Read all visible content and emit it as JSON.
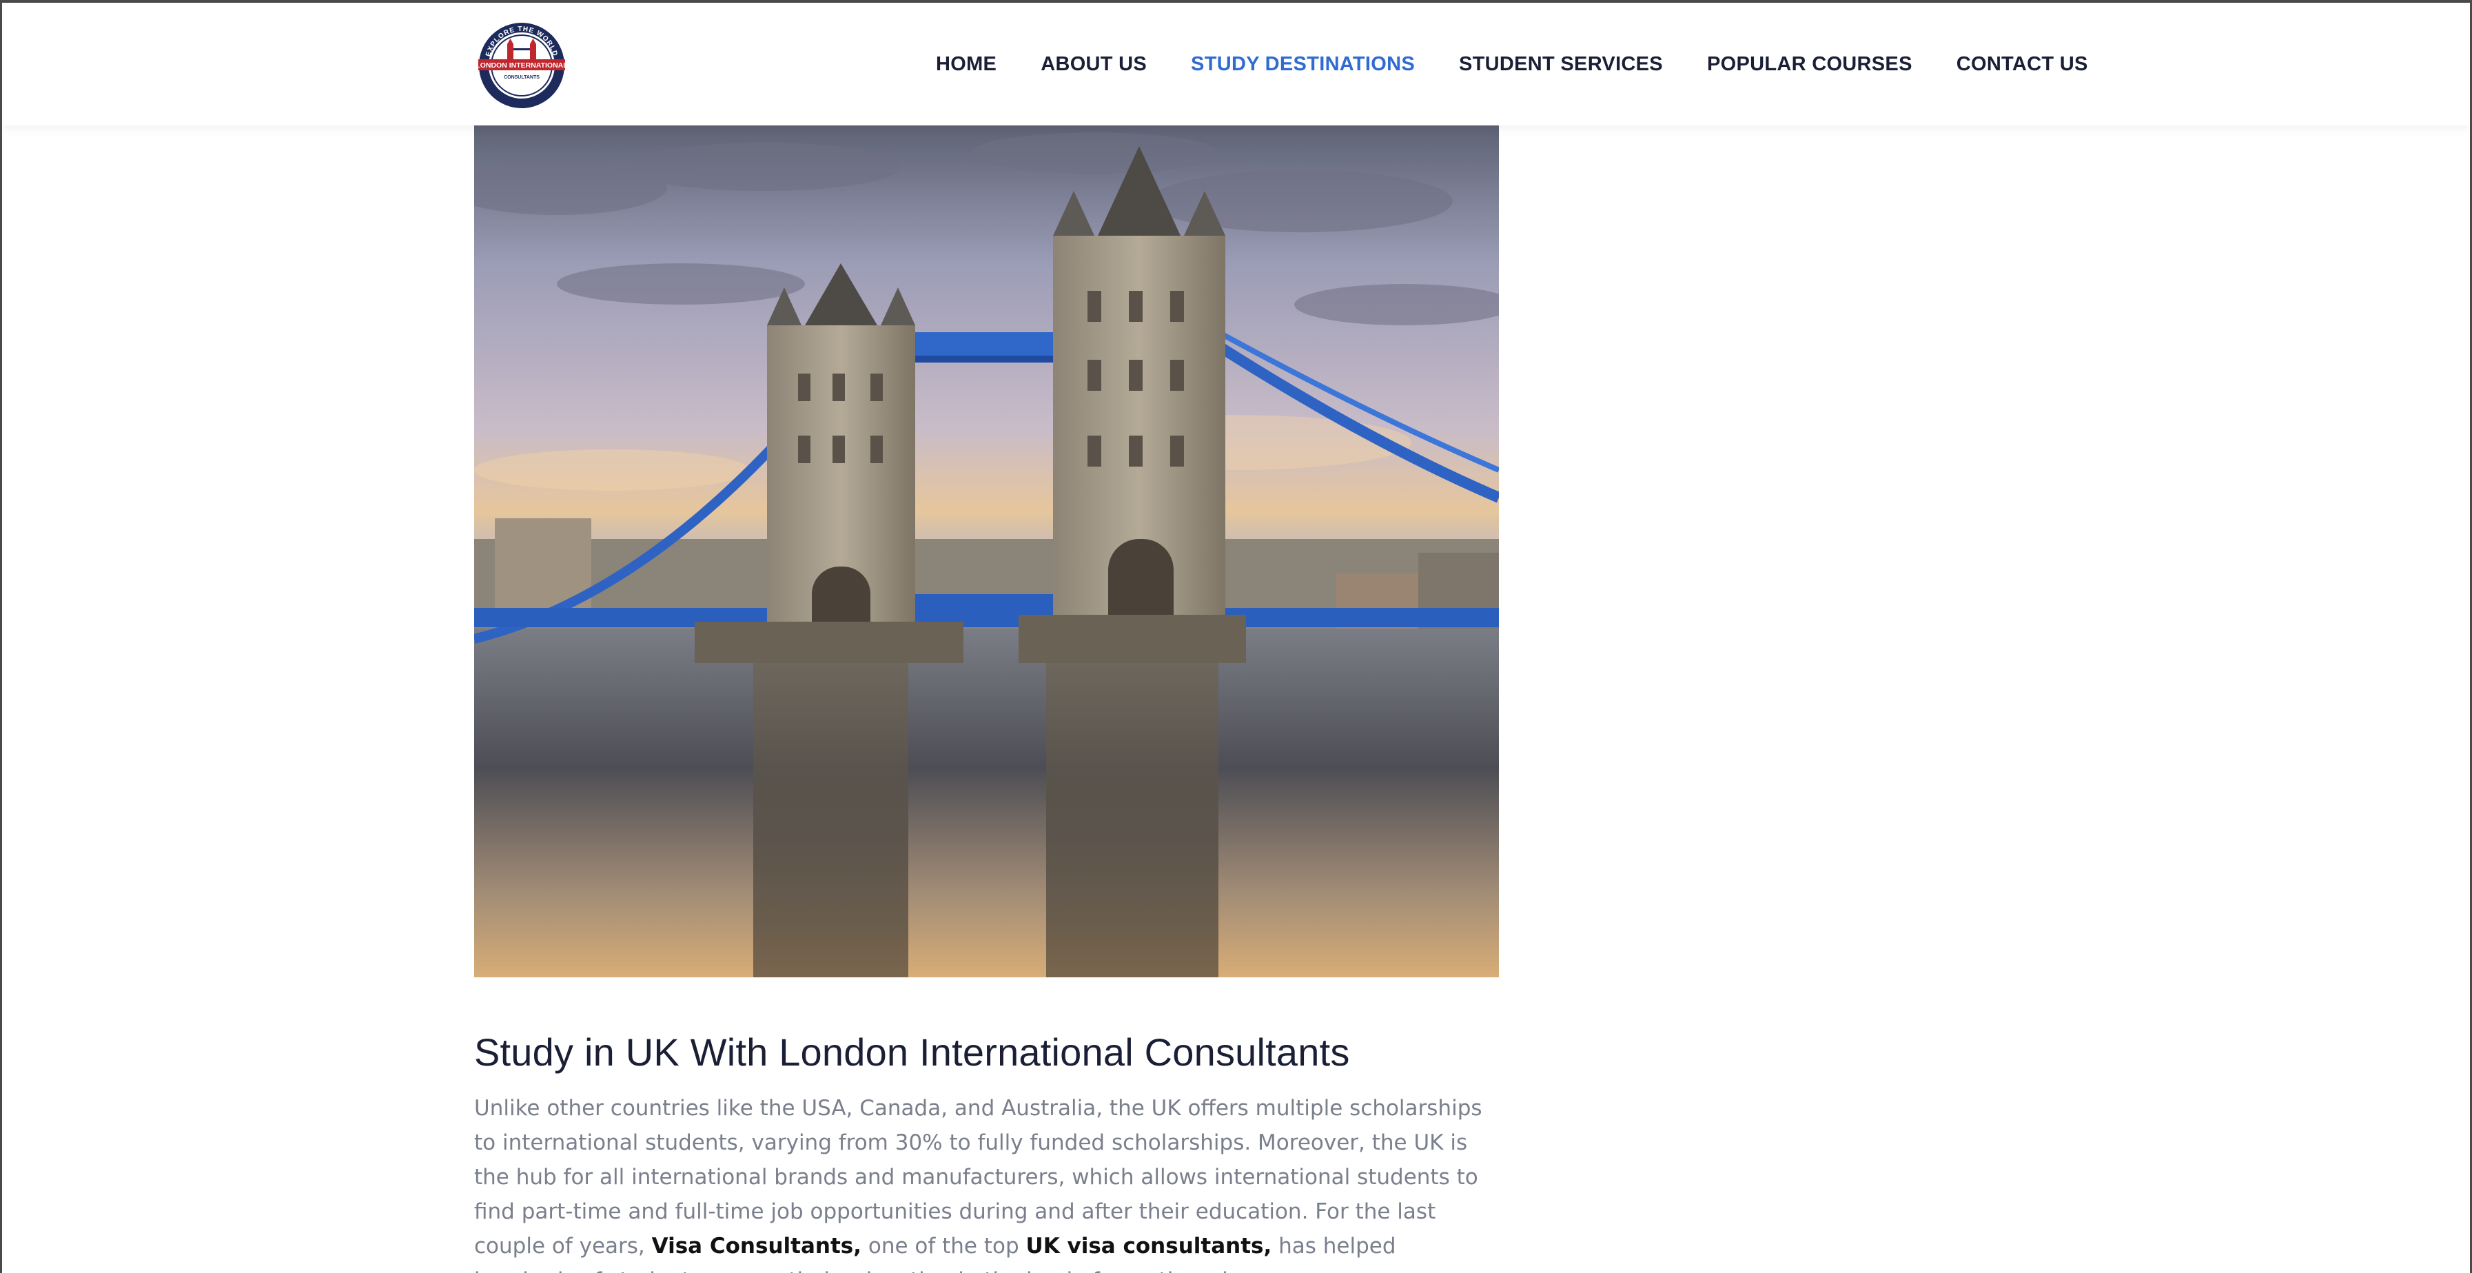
{
  "header": {
    "logo": {
      "top_text": "EXPLORE THE WORLD",
      "band_text": "LONDON INTERNATIONAL",
      "sub_text": "CONSULTANTS",
      "bottom_text": "YOUR FUTURE STARTS HERE"
    },
    "nav": [
      {
        "label": "HOME",
        "active": false
      },
      {
        "label": "ABOUT US",
        "active": false
      },
      {
        "label": "STUDY DESTINATIONS",
        "active": true
      },
      {
        "label": "STUDENT SERVICES",
        "active": false
      },
      {
        "label": "POPULAR COURSES",
        "active": false
      },
      {
        "label": "CONTACT US",
        "active": false
      }
    ]
  },
  "colors": {
    "accent": "#2f6bd1",
    "nav_text": "#1a1f36",
    "body_text": "#7a7f8c",
    "logo_red": "#c0262d",
    "logo_navy": "#1d2a5c"
  },
  "hero": {
    "subject": "Tower Bridge over the River Thames at sunset"
  },
  "article": {
    "title": "Study in UK With London International Consultants",
    "segments": {
      "s1": "Unlike other countries like the USA, Canada, and Australia, the UK offers multiple scholarships to international students, varying from 30% to fully funded scholarships. Moreover, the UK is the hub for all international brands and manufacturers, which allows international students to find part-time and full-time job opportunities during and after their education. For the last couple of years, ",
      "link1": "Visa Consultants,",
      "s2": " one of the top ",
      "link2": "UK visa consultants,",
      "s3": " has helped hundreds of students pursue their education in the land of growth and"
    }
  }
}
